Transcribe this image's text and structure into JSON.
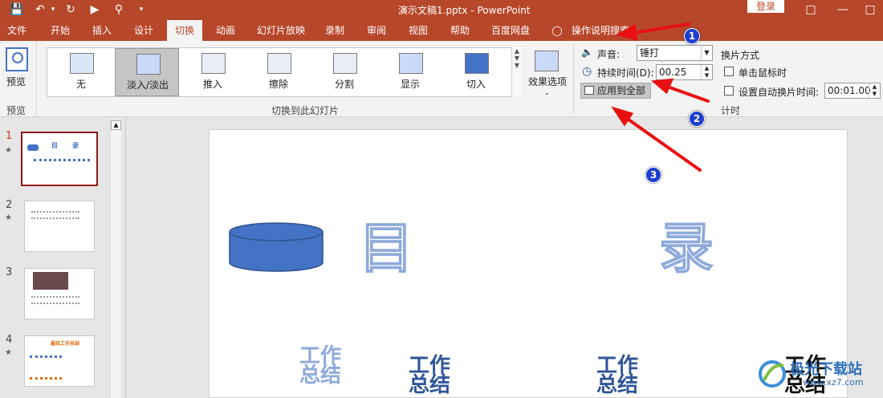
{
  "titlebar": {
    "title": "演示文稿1.pptx  -  PowerPoint",
    "login": "登录"
  },
  "tabs": [
    {
      "label": "文件"
    },
    {
      "label": "开始"
    },
    {
      "label": "插入"
    },
    {
      "label": "设计"
    },
    {
      "label": "切换"
    },
    {
      "label": "动画"
    },
    {
      "label": "幻灯片放映"
    },
    {
      "label": "录制"
    },
    {
      "label": "审阅"
    },
    {
      "label": "视图"
    },
    {
      "label": "帮助"
    },
    {
      "label": "百度网盘"
    }
  ],
  "tellme": "操作说明搜索",
  "ribbon": {
    "preview_label": "预览",
    "preview_group": "预览",
    "transitions": [
      {
        "label": "无"
      },
      {
        "label": "淡入/淡出"
      },
      {
        "label": "推入"
      },
      {
        "label": "擦除"
      },
      {
        "label": "分割"
      },
      {
        "label": "显示"
      },
      {
        "label": "切入"
      }
    ],
    "transitions_group": "切换到此幻灯片",
    "effect_options": "效果选项",
    "sound_label": "声音:",
    "sound_value": "锤打",
    "duration_label": "持续时间(D):",
    "duration_value": "00.25",
    "apply_all": "应用到全部",
    "advance_title": "换片方式",
    "on_click": "单击鼠标时",
    "after_time": "设置自动换片时间:",
    "after_value": "00:01.00",
    "timing_group": "计时"
  },
  "slides": [
    {
      "num": "1",
      "title_left": "目",
      "title_right": "录"
    },
    {
      "num": "2"
    },
    {
      "num": "3"
    },
    {
      "num": "4",
      "title": "最炫工作总结"
    }
  ],
  "canvas": {
    "title_left": "目",
    "title_right": "录",
    "items": [
      "工作\n总结",
      "工作\n总结",
      "工作\n总结",
      "工作\n总结"
    ]
  },
  "markers": [
    "1",
    "2",
    "3"
  ],
  "watermark": {
    "text": "极光下载站",
    "url": "www.xz7.com"
  }
}
